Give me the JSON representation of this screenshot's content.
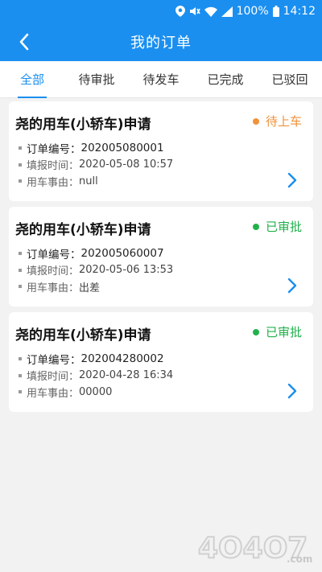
{
  "status_bar": {
    "battery": "100%",
    "time": "14:12"
  },
  "header": {
    "title": "我的订单"
  },
  "tabs": [
    {
      "label": "全部",
      "active": true
    },
    {
      "label": "待审批",
      "active": false
    },
    {
      "label": "待发车",
      "active": false
    },
    {
      "label": "已完成",
      "active": false
    },
    {
      "label": "已驳回",
      "active": false
    }
  ],
  "orders": [
    {
      "title": "尧的用车(小轿车)申请",
      "status": "待上车",
      "status_color": "#f0923a",
      "order_no_label": "订单编号：",
      "order_no": "202005080001",
      "time_label": "填报时间：",
      "time": "2020-05-08 10:57",
      "reason_label": "用车事由：",
      "reason": "null"
    },
    {
      "title": "尧的用车(小轿车)申请",
      "status": "已审批",
      "status_color": "#22b14c",
      "order_no_label": "订单编号：",
      "order_no": "202005060007",
      "time_label": "填报时间：",
      "time": "2020-05-06 13:53",
      "reason_label": "用车事由：",
      "reason": "出差"
    },
    {
      "title": "尧的用车(小轿车)申请",
      "status": "已审批",
      "status_color": "#22b14c",
      "order_no_label": "订单编号：",
      "order_no": "202004280002",
      "time_label": "填报时间：",
      "time": "2020-04-28 16:34",
      "reason_label": "用车事由：",
      "reason": "00000"
    }
  ],
  "watermark": {
    "text": "4O4O7",
    "suffix": ".com"
  },
  "colors": {
    "primary": "#1a8ff0",
    "chevron": "#1a8ff0"
  }
}
